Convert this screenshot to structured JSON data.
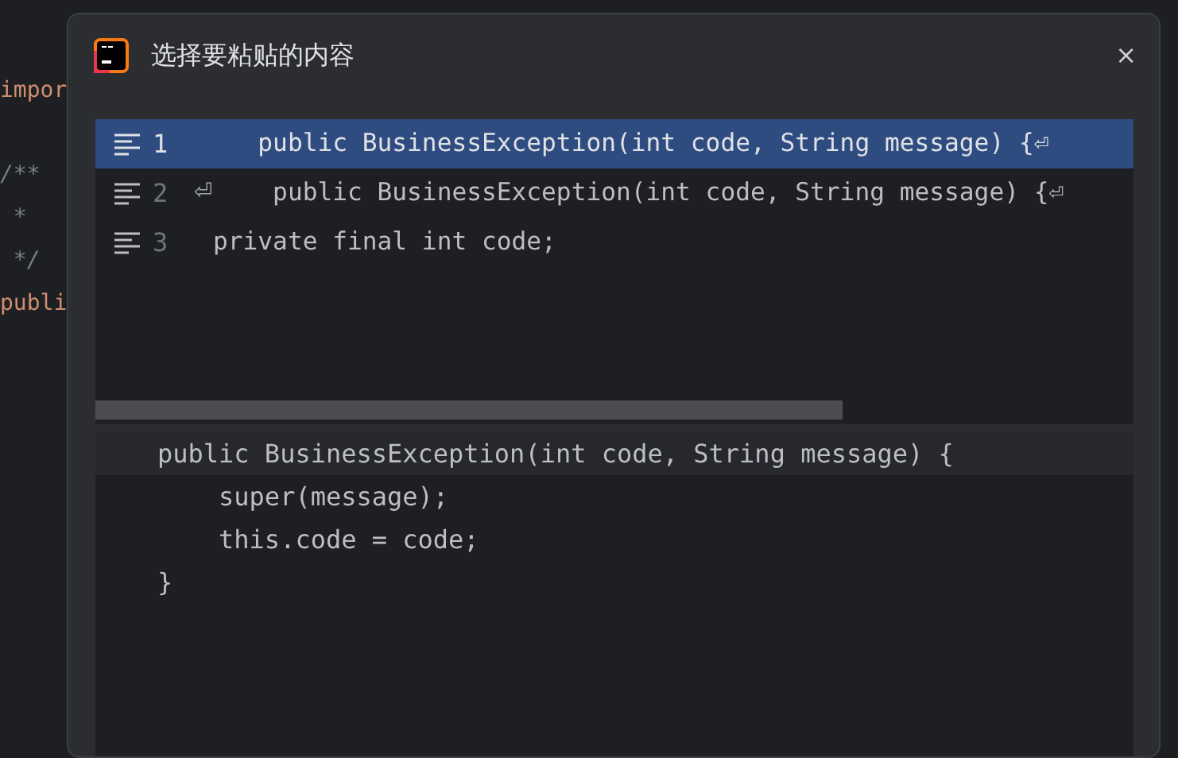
{
  "editor": {
    "lines": [
      "impor",
      "/**",
      " *",
      " */",
      "publi"
    ]
  },
  "dialog": {
    "title": "选择要粘贴的内容",
    "close_symbol": "×",
    "items": [
      {
        "number": "1",
        "selected": true,
        "text": "   public BusinessException(int code, String message) {⏎"
      },
      {
        "number": "2",
        "selected": false,
        "prefix": "⏎",
        "text": "    public BusinessException(int code, String message) {⏎"
      },
      {
        "number": "3",
        "selected": false,
        "text": "private final int code;"
      }
    ],
    "preview": {
      "lines": [
        {
          "text": "public BusinessException(int code, String message) {",
          "current": true
        },
        {
          "text": "    super(message);",
          "current": false
        },
        {
          "text": "    this.code = code;",
          "current": false
        },
        {
          "text": "}",
          "current": false
        }
      ]
    }
  }
}
